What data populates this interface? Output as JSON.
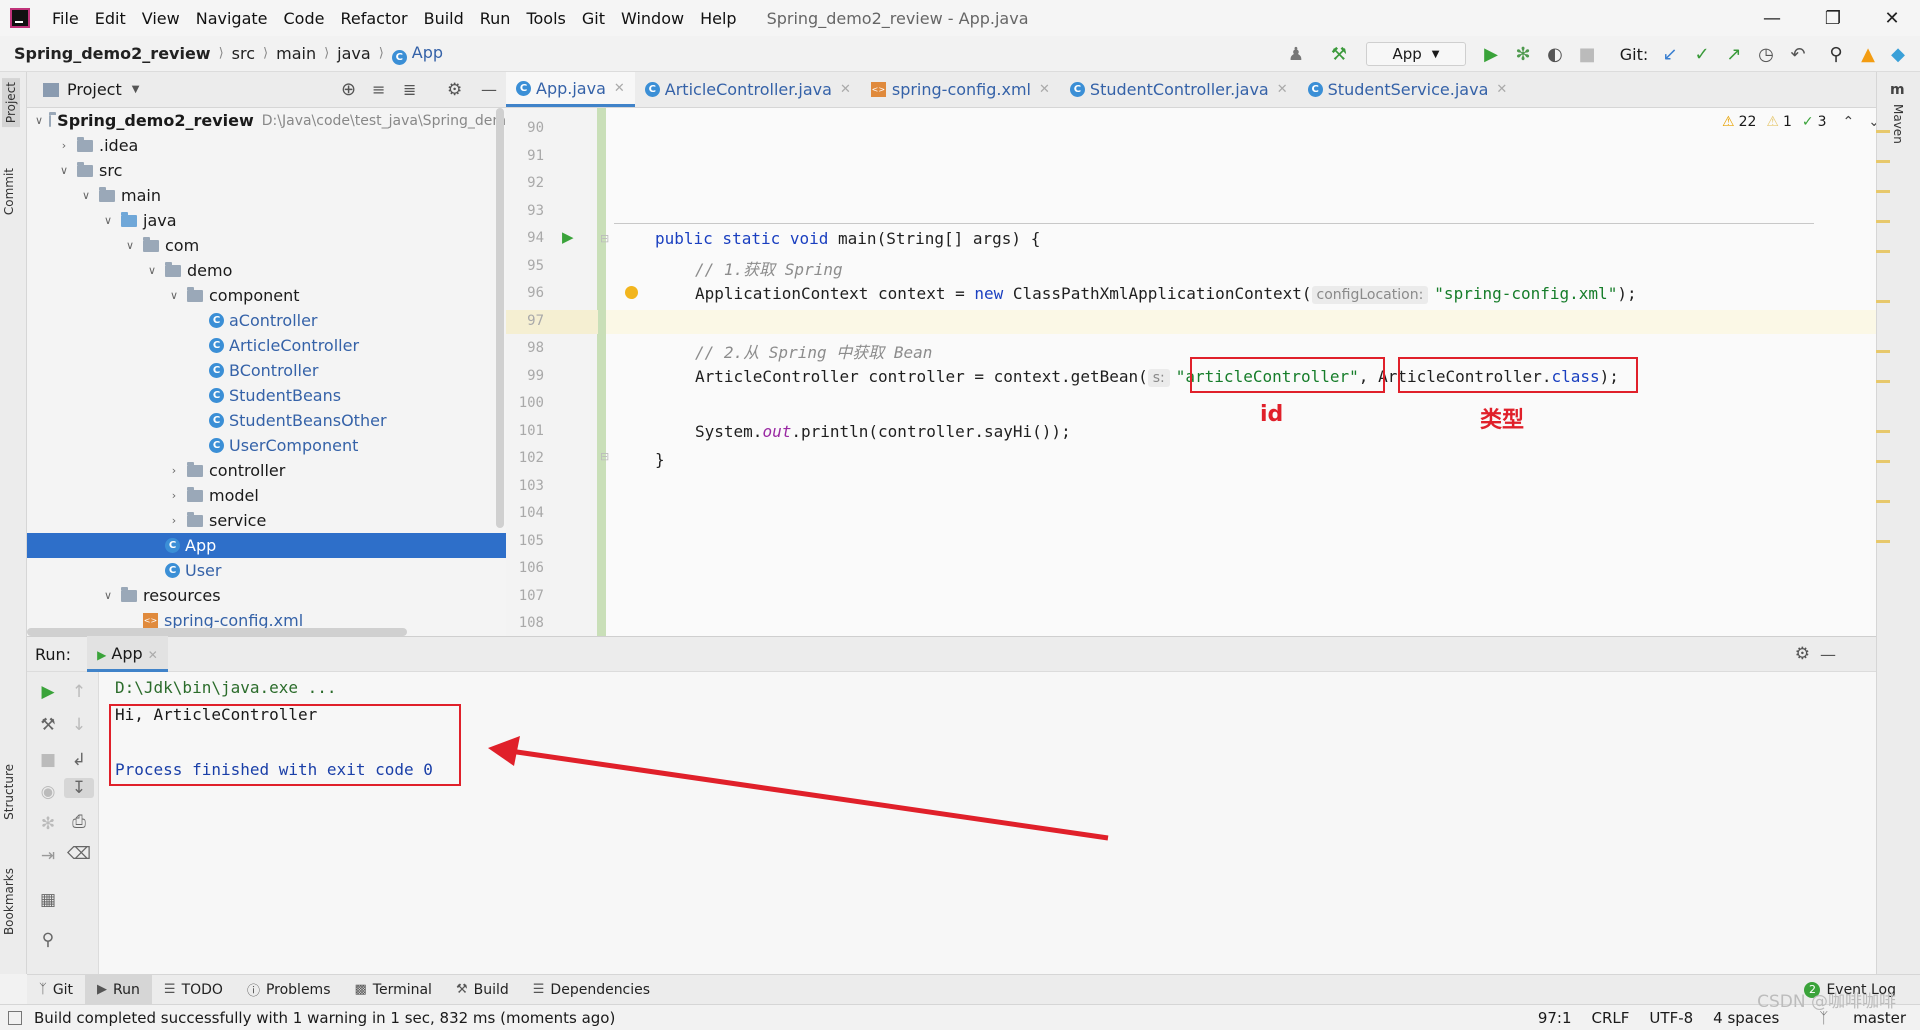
{
  "menu": {
    "items": [
      "File",
      "Edit",
      "View",
      "Navigate",
      "Code",
      "Refactor",
      "Build",
      "Run",
      "Tools",
      "Git",
      "Window",
      "Help"
    ],
    "title": "Spring_demo2_review - App.java"
  },
  "nav": {
    "crumbs": [
      "Spring_demo2_review",
      "src",
      "main",
      "java",
      "App"
    ],
    "run_config": "App",
    "git_label": "Git:"
  },
  "left_strip": {
    "project": "Project",
    "commit": "Commit",
    "structure": "Structure",
    "bookmarks": "Bookmarks"
  },
  "right_strip": {
    "maven": "Maven"
  },
  "project_panel": {
    "title": "Project",
    "tree": [
      {
        "label": "Spring_demo2_review",
        "hint": "D:\\Java\\code\\test_java\\Spring_dem",
        "depth": 0,
        "kind": "module",
        "open": true
      },
      {
        "label": ".idea",
        "depth": 1,
        "kind": "folder",
        "open": false
      },
      {
        "label": "src",
        "depth": 1,
        "kind": "folder",
        "open": true
      },
      {
        "label": "main",
        "depth": 2,
        "kind": "folder",
        "open": true
      },
      {
        "label": "java",
        "depth": 3,
        "kind": "folder-blue",
        "open": true
      },
      {
        "label": "com",
        "depth": 4,
        "kind": "folder",
        "open": true
      },
      {
        "label": "demo",
        "depth": 5,
        "kind": "folder",
        "open": true
      },
      {
        "label": "component",
        "depth": 6,
        "kind": "folder",
        "open": true
      },
      {
        "label": "aController",
        "depth": 7,
        "kind": "class"
      },
      {
        "label": "ArticleController",
        "depth": 7,
        "kind": "class"
      },
      {
        "label": "BController",
        "depth": 7,
        "kind": "class"
      },
      {
        "label": "StudentBeans",
        "depth": 7,
        "kind": "class"
      },
      {
        "label": "StudentBeansOther",
        "depth": 7,
        "kind": "class"
      },
      {
        "label": "UserComponent",
        "depth": 7,
        "kind": "class"
      },
      {
        "label": "controller",
        "depth": 6,
        "kind": "folder",
        "open": false
      },
      {
        "label": "model",
        "depth": 6,
        "kind": "folder",
        "open": false
      },
      {
        "label": "service",
        "depth": 6,
        "kind": "folder",
        "open": false
      },
      {
        "label": "App",
        "depth": 5,
        "kind": "class",
        "selected": true
      },
      {
        "label": "User",
        "depth": 5,
        "kind": "class"
      },
      {
        "label": "resources",
        "depth": 3,
        "kind": "folder",
        "open": true
      },
      {
        "label": "spring-config.xml",
        "depth": 4,
        "kind": "xml"
      }
    ]
  },
  "editor": {
    "tabs": [
      {
        "label": "App.java",
        "active": true,
        "icon": "class-icon"
      },
      {
        "label": "ArticleController.java",
        "icon": "class-icon"
      },
      {
        "label": "spring-config.xml",
        "icon": "xml-icon"
      },
      {
        "label": "StudentController.java",
        "icon": "class-icon"
      },
      {
        "label": "StudentService.java",
        "icon": "class-icon"
      }
    ],
    "inspections": {
      "warnings": "22",
      "weak_warnings": "1",
      "ok": "3"
    },
    "line_numbers": [
      "90",
      "91",
      "92",
      "93",
      "94",
      "95",
      "96",
      "97",
      "98",
      "99",
      "100",
      "101",
      "102",
      "103",
      "104",
      "105",
      "106",
      "107",
      "108"
    ],
    "code": {
      "l94_kw": "public static void ",
      "l94_rest": "main(String[] args) {",
      "l95": "// 1.获取 Spring",
      "l96_a": "ApplicationContext context = ",
      "l96_new": "new ",
      "l96_b": "ClassPathXmlApplicationContext(",
      "l96_hint": "configLocation:",
      "l96_str": "\"spring-config.xml\"",
      "l96_end": ");",
      "l98": "// 2.从 Spring 中获取 Bean",
      "l99_a": "ArticleController controller = context.getBean(",
      "l99_hint": "s:",
      "l99_str": "\"articleController\"",
      "l99_comma": ", ",
      "l99_cls": "ArticleController.",
      "l99_class_kw": "class",
      "l99_end": ");",
      "l101_a": "System.",
      "l101_out": "out",
      "l101_b": ".println(controller.sayHi());",
      "l102": "}"
    },
    "annotations": {
      "id_label": "id",
      "type_label": "类型"
    }
  },
  "run_panel": {
    "label": "Run:",
    "tab": "App",
    "console": {
      "cmd": "D:\\Jdk\\bin\\java.exe ...",
      "output": "Hi, ArticleController",
      "exit": "Process finished with exit code 0"
    }
  },
  "tool_windows": [
    "Git",
    "Run",
    "TODO",
    "Problems",
    "Terminal",
    "Build",
    "Dependencies"
  ],
  "event_log": {
    "count": "2",
    "label": "Event Log"
  },
  "status": {
    "message": "Build completed successfully with 1 warning in 1 sec, 832 ms (moments ago)",
    "position": "97:1",
    "line_sep": "CRLF",
    "encoding": "UTF-8",
    "indent": "4 spaces",
    "branch": "master"
  },
  "watermark": "CSDN @咖啡咖啡"
}
